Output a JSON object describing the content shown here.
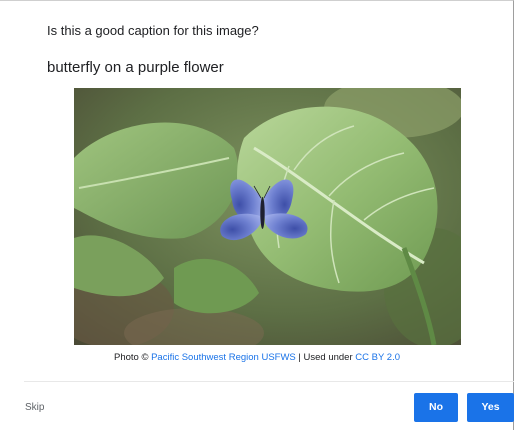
{
  "prompt": {
    "question": "Is this a good caption for this image?",
    "caption": "butterfly on a purple flower"
  },
  "image": {
    "subject": "blue butterfly resting on a green leaf",
    "credit_prefix": "Photo ©",
    "credit_author": "Pacific Southwest Region USFWS",
    "credit_separator": "| Used under",
    "credit_license": "CC BY 2.0"
  },
  "footer": {
    "skip_label": "Skip",
    "no_label": "No",
    "yes_label": "Yes"
  },
  "colors": {
    "accent": "#1a73e8",
    "text": "#202124",
    "muted": "#5f6368"
  }
}
